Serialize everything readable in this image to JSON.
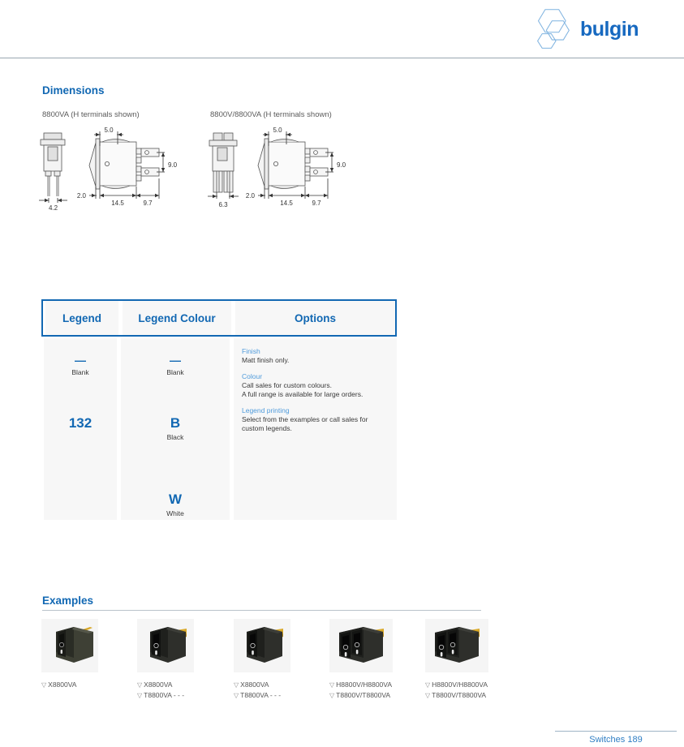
{
  "brand": {
    "name": "bulgin",
    "logo_icon": "hexagon-logo-icon",
    "accent_color": "#1268b3"
  },
  "dimensions_section": {
    "title": "Dimensions",
    "drawings": [
      {
        "caption": "8800VA (H terminals shown)",
        "labels": {
          "width": "5.0",
          "front_width": "4.2",
          "bezel": "2.0",
          "body": "14.5",
          "terminal": "9.7",
          "height": "9.0"
        }
      },
      {
        "caption": "8800V/8800VA (H terminals shown)",
        "labels": {
          "width": "5.0",
          "front_width": "6.3",
          "bezel": "2.0",
          "body": "14.5",
          "terminal": "9.7",
          "height": "9.0"
        }
      }
    ]
  },
  "options_table": {
    "headers": [
      "Legend",
      "Legend Colour",
      "Options"
    ],
    "legend": [
      {
        "code": "—",
        "label": "Blank"
      },
      {
        "code": "132",
        "label": ""
      }
    ],
    "legend_colour": [
      {
        "code": "—",
        "label": "Blank"
      },
      {
        "code": "B",
        "label": "Black"
      },
      {
        "code": "W",
        "label": "White"
      }
    ],
    "options": [
      {
        "heading": "Finish",
        "body": "Matt finish only."
      },
      {
        "heading": "Colour",
        "body": "Call sales for custom colours.\nA full range is available for large orders."
      },
      {
        "heading": "Legend printing",
        "body": "Select from the examples or call sales for custom legends."
      }
    ]
  },
  "examples_section": {
    "title": "Examples",
    "items": [
      {
        "image": "rocker-switch-single-olive",
        "type": "single",
        "lines": [
          "X8800VA"
        ]
      },
      {
        "image": "rocker-switch-single-black",
        "type": "single",
        "lines": [
          "X8800VA",
          "T8800VA - - -"
        ]
      },
      {
        "image": "rocker-switch-single-black-alt",
        "type": "single",
        "lines": [
          "X8800VA",
          "T8800VA - - -"
        ]
      },
      {
        "image": "rocker-switch-double-black",
        "type": "double",
        "lines": [
          "H8800V/H8800VA",
          "T8800V/T8800VA"
        ]
      },
      {
        "image": "rocker-switch-double-black-alt",
        "type": "double",
        "lines": [
          "H8800V/H8800VA",
          "T8800V/T8800VA"
        ]
      }
    ]
  },
  "footer": {
    "text": "Switches  189"
  }
}
